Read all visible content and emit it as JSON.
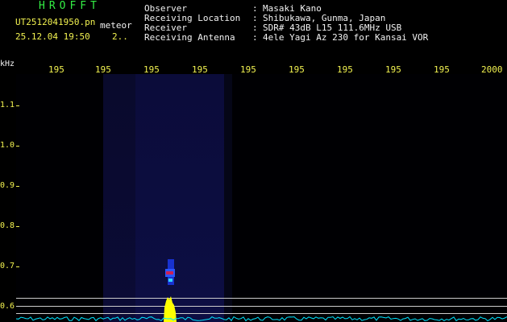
{
  "header": {
    "app_title": "HROFFT",
    "file_name": "UT2512041950.pn",
    "mode": "meteor",
    "timestamp": "25.12.04 19:50",
    "count": "2..",
    "info": [
      {
        "label": "Observer",
        "value": "Masaki Kano"
      },
      {
        "label": "Receiving Location",
        "value": "Shibukawa, Gunma, Japan"
      },
      {
        "label": "Receiver",
        "value": "SDR# 43dB L15 111.6MHz USB"
      },
      {
        "label": "Receiving Antenna",
        "value": "4ele Yagi Az 230 for Kansai VOR"
      }
    ]
  },
  "axes": {
    "y_unit": "kHz",
    "y_ticks": [
      "1.1",
      "1.0",
      "0.9",
      "0.8",
      "0.7",
      "0.6"
    ],
    "x_ticks": [
      "195",
      "195",
      "195",
      "195",
      "195",
      "195",
      "195",
      "195",
      "195",
      "2000"
    ]
  },
  "colors": {
    "green_text": "#33ee44",
    "yellow_text": "#f2f250",
    "white_text": "#f2f2f2",
    "signal_low": "#1c3fff",
    "signal_mid": "#cc2255",
    "signal_peak": "#ffff00",
    "noise_floor": "#00e6ff"
  }
}
